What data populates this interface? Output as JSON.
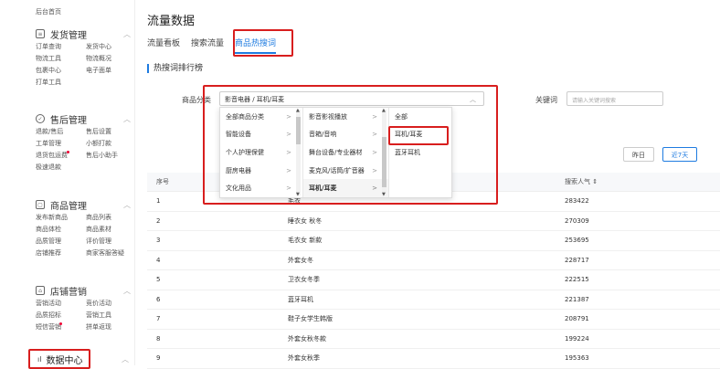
{
  "sidebar": {
    "home": "后台首页",
    "groups": [
      {
        "title": "发货管理",
        "icon": "document-icon",
        "rows": [
          [
            "订单查询",
            "发货中心"
          ],
          [
            "物流工具",
            "物流概况"
          ],
          [
            "包裹中心",
            "电子面单"
          ],
          [
            "打单工具",
            ""
          ]
        ]
      },
      {
        "title": "售后管理",
        "icon": "shield-icon",
        "rows": [
          [
            "退款/售后",
            "售后设置"
          ],
          [
            "工单管理",
            "小额打款"
          ],
          [
            "退货包运费",
            "售后小助手"
          ],
          [
            "极速退款",
            ""
          ]
        ]
      },
      {
        "title": "商品管理",
        "icon": "box-icon",
        "rows": [
          [
            "发布新商品",
            "商品列表"
          ],
          [
            "商品体检",
            "商品素材"
          ],
          [
            "品质管理",
            "评价管理"
          ],
          [
            "店铺推荐",
            "商家客服答疑"
          ]
        ]
      },
      {
        "title": "店铺营销",
        "icon": "gift-icon",
        "rows": [
          [
            "营销活动",
            "竞价活动"
          ],
          [
            "品质招标",
            "营销工具"
          ],
          [
            "短信营销",
            "拼单返现"
          ]
        ]
      }
    ],
    "data_center": "数据中心"
  },
  "page_title": "流量数据",
  "tabs": [
    "流量看板",
    "搜索流量",
    "商品热搜词"
  ],
  "section_title": "热搜词排行榜",
  "filter": {
    "category_label": "商品分类",
    "category_value": "影音电器 / 耳机/耳麦",
    "keyword_label": "关键词",
    "keyword_placeholder": "请输入关键词搜索"
  },
  "cascader": {
    "col1": [
      "全部商品分类",
      "智能设备",
      "个人护理保健",
      "厨房电器",
      "文化用品"
    ],
    "col2": [
      "影音影视播放",
      "音箱/音响",
      "舞台设备/专业器材",
      "麦克风/话筒/扩音器",
      "耳机/耳麦"
    ],
    "col3": [
      "全部",
      "耳机/耳麦",
      "蓝牙耳机"
    ]
  },
  "date_buttons": {
    "yesterday": "昨日",
    "seven_days": "近7天"
  },
  "table": {
    "headers": {
      "index": "序号",
      "popularity": "搜索人气 ⇕"
    },
    "rows": [
      {
        "index": "1",
        "keyword": "毛衣",
        "popularity": "283422"
      },
      {
        "index": "2",
        "keyword": "睡衣女 秋冬",
        "popularity": "270309"
      },
      {
        "index": "3",
        "keyword": "毛衣女 新款",
        "popularity": "253695"
      },
      {
        "index": "4",
        "keyword": "外套女冬",
        "popularity": "228717"
      },
      {
        "index": "5",
        "keyword": "卫衣女冬季",
        "popularity": "222515"
      },
      {
        "index": "6",
        "keyword": "蓝牙耳机",
        "popularity": "221387"
      },
      {
        "index": "7",
        "keyword": "鞋子女学生韩版",
        "popularity": "208791"
      },
      {
        "index": "8",
        "keyword": "外套女秋冬款",
        "popularity": "199224"
      },
      {
        "index": "9",
        "keyword": "外套女秋季",
        "popularity": "195363"
      }
    ]
  }
}
